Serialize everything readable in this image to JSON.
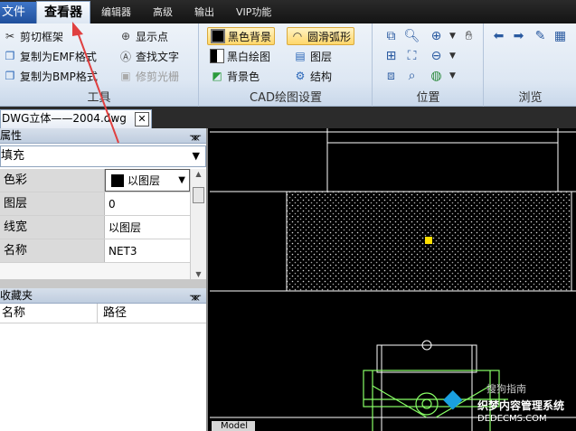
{
  "menu": {
    "items": [
      "文件",
      "查看器",
      "编辑器",
      "高级",
      "输出",
      "VIP功能"
    ],
    "active": "查看器"
  },
  "ribbon": {
    "tools": {
      "label": "工具",
      "buttons": [
        "剪切框架",
        "复制为EMF格式",
        "复制为BMP格式",
        "显示点",
        "查找文字",
        "修剪光栅"
      ]
    },
    "cad": {
      "label": "CAD绘图设置",
      "buttons": [
        "黑色背景",
        "黑白绘图",
        "背景色",
        "圆滑弧形",
        "图层",
        "结构"
      ]
    },
    "position": {
      "label": "位置"
    },
    "browse": {
      "label": "浏览"
    }
  },
  "document_tab": {
    "title": "DWG立体——2004.dwg",
    "close": "✕"
  },
  "properties_panel": {
    "title": "属性",
    "combo_value": "填充",
    "rows": [
      {
        "name": "色彩",
        "value": "以图层"
      },
      {
        "name": "图层",
        "value": "0"
      },
      {
        "name": "线宽",
        "value": "以图层"
      },
      {
        "name": "名称",
        "value": "NET3"
      }
    ]
  },
  "favorites_panel": {
    "title": "收藏夹",
    "columns": [
      "名称",
      "路径"
    ]
  },
  "canvas": {
    "tab": "Model"
  },
  "watermark": {
    "line1": "搜狗指南",
    "line2": "织梦内容管理系统",
    "line3": "DEDECMS.COM"
  },
  "colors": {
    "ribbon_bg": "#dde7f3",
    "active_tab": "#fafcff",
    "annotation_arrow": "#e04040",
    "cad_lines": "#ffffff",
    "model_lines": "#88ff66"
  }
}
